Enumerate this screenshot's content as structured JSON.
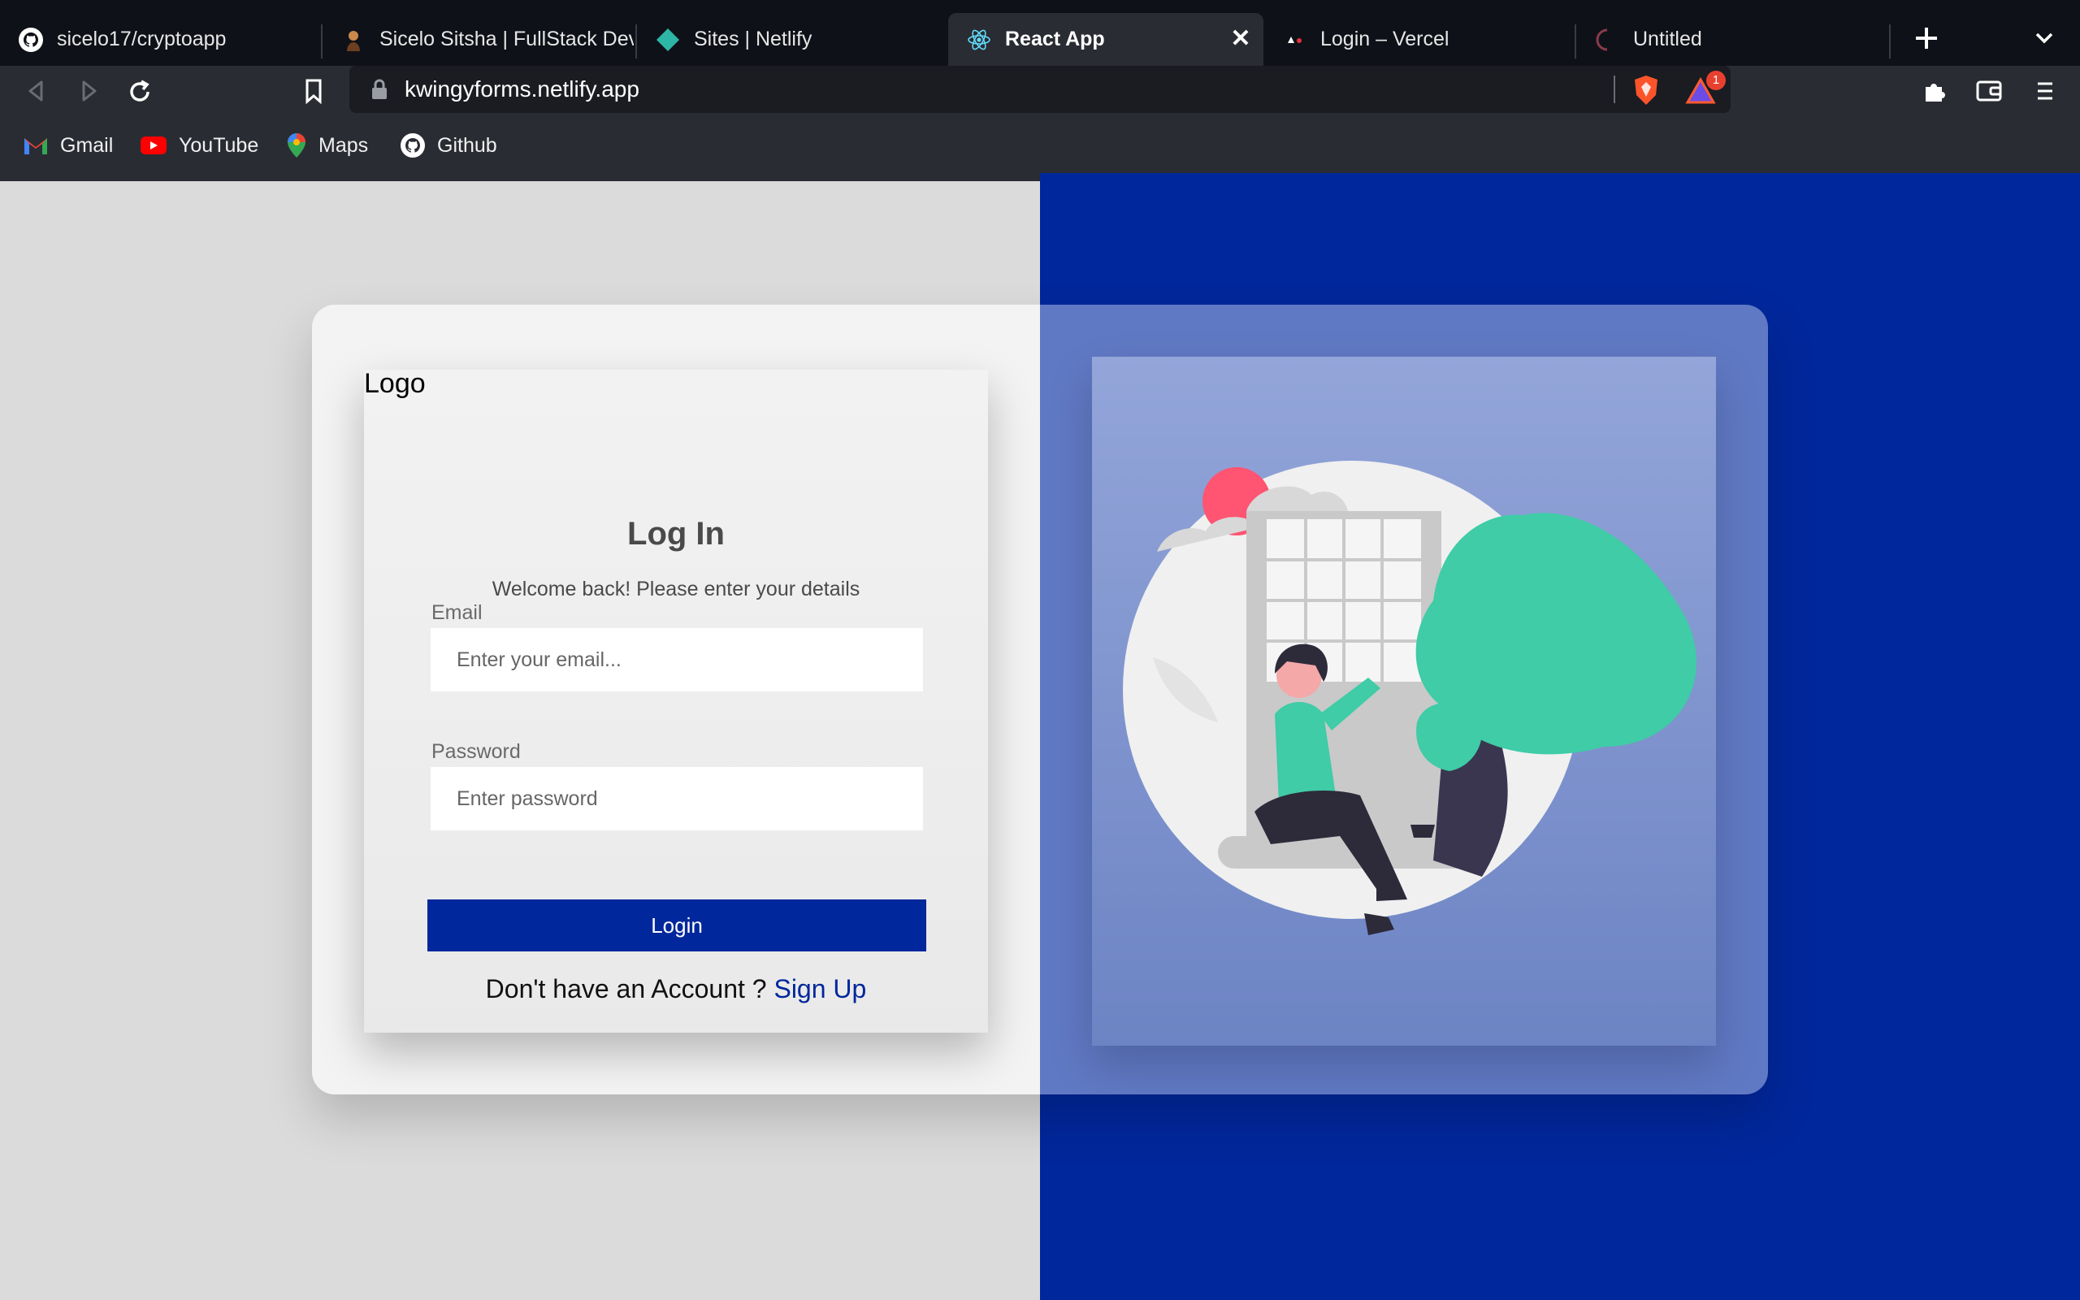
{
  "browser": {
    "tabs": [
      {
        "title": "sicelo17/cryptoapp",
        "icon": "github-icon"
      },
      {
        "title": "Sicelo Sitsha | FullStack Developer",
        "icon": "avatar-icon"
      },
      {
        "title": "Sites | Netlify",
        "icon": "netlify-icon"
      },
      {
        "title": "React App",
        "icon": "react-icon",
        "active": true
      },
      {
        "title": "Login – Vercel",
        "icon": "vercel-icon"
      },
      {
        "title": "Untitled",
        "icon": "loading-icon"
      }
    ],
    "url": "kwingyforms.netlify.app",
    "shields_badge": "1",
    "bookmarks": [
      {
        "label": "Gmail",
        "icon": "gmail-icon"
      },
      {
        "label": "YouTube",
        "icon": "youtube-icon"
      },
      {
        "label": "Maps",
        "icon": "maps-icon"
      },
      {
        "label": "Github",
        "icon": "github-icon"
      }
    ]
  },
  "page": {
    "logo": "Logo",
    "title": "Log In",
    "subtitle": "Welcome back! Please enter your details",
    "email_label": "Email",
    "email_placeholder": "Enter your email...",
    "password_label": "Password",
    "password_placeholder": "Enter password",
    "login_button": "Login",
    "signup_prompt": "Don't have an Account ?",
    "signup_link": "Sign Up",
    "colors": {
      "brand": "#00279c",
      "accent_green": "#3fcca6",
      "accent_pink": "#ff5472"
    }
  }
}
